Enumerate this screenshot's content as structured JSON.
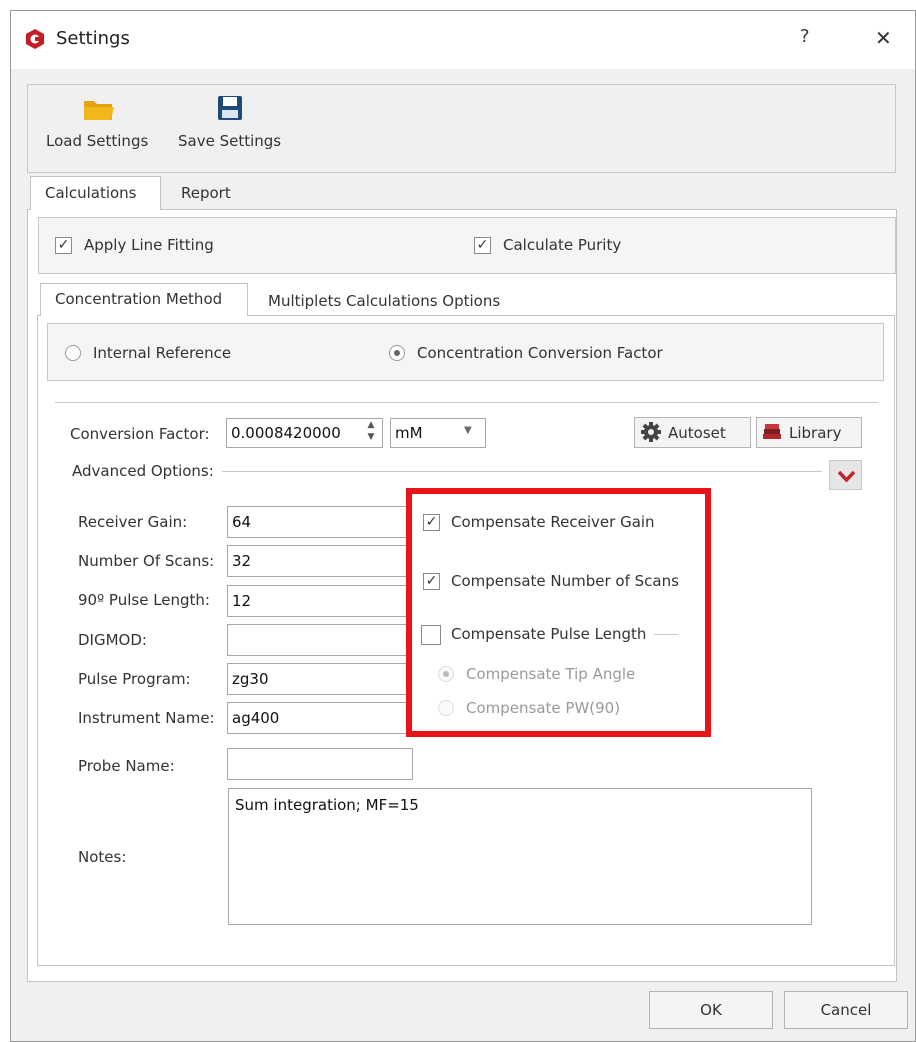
{
  "window": {
    "title": "Settings",
    "help": "?",
    "close": "✕"
  },
  "toolbar": {
    "load_label": "Load Settings",
    "save_label": "Save Settings"
  },
  "tabs": {
    "calculations": "Calculations",
    "report": "Report"
  },
  "options": {
    "apply_line_fitting": "Apply Line Fitting",
    "calculate_purity": "Calculate Purity"
  },
  "subtabs": {
    "concentration_method": "Concentration Method",
    "multiplets": "Multiplets Calculations Options"
  },
  "method": {
    "internal_reference": "Internal Reference",
    "conversion_factor_option": "Concentration Conversion Factor",
    "selected": "Concentration Conversion Factor"
  },
  "conversion": {
    "label": "Conversion Factor:",
    "value": "0.0008420000",
    "unit": "mM",
    "autoset": "Autoset",
    "library": "Library"
  },
  "advanced": {
    "label": "Advanced Options:"
  },
  "fields": {
    "receiver_gain_label": "Receiver Gain:",
    "receiver_gain": "64",
    "scans_label": "Number Of Scans:",
    "scans": "32",
    "pulse_label": "90º Pulse Length:",
    "pulse": "12",
    "digmod_label": "DIGMOD:",
    "digmod": "",
    "program_label": "Pulse Program:",
    "program": "zg30",
    "instrument_label": "Instrument Name:",
    "instrument": "ag400",
    "probe_label": "Probe Name:",
    "probe": "",
    "notes_label": "Notes:",
    "notes": "Sum integration; MF=15"
  },
  "compensate": {
    "receiver_gain": "Compensate Receiver Gain",
    "receiver_gain_checked": true,
    "scans": "Compensate Number of Scans",
    "scans_checked": true,
    "pulse_length": "Compensate Pulse Length",
    "pulse_length_checked": false,
    "tip_angle": "Compensate Tip Angle",
    "pw90": "Compensate PW(90)"
  },
  "footer": {
    "ok": "OK",
    "cancel": "Cancel"
  },
  "colors": {
    "highlight": "#e8141a",
    "chevron": "#c0262c",
    "folder": "#f3b71c",
    "disk": "#1f4b7a"
  }
}
